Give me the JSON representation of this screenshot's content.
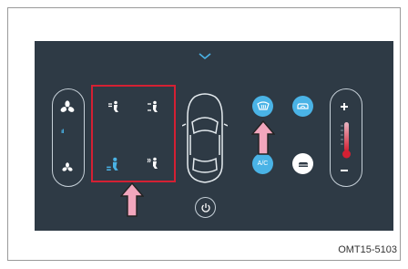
{
  "panel": {
    "ac_label": "A/C",
    "fan_level_bars": "ıılll"
  },
  "footer": {
    "code": "OMT15-5103"
  },
  "colors": {
    "panel_bg": "#2e3a45",
    "active_blue": "#4ab3e6",
    "highlight_red": "#d42033",
    "arrow_pink": "#f2a6bd"
  },
  "icons": {
    "collapse": "chevron-down-icon",
    "fan_high": "fan-icon",
    "fan_low": "fan-icon",
    "mode_face": "vent-face-icon",
    "mode_face_feet": "vent-face-feet-icon",
    "mode_feet": "vent-feet-icon",
    "mode_feet_defrost": "vent-feet-defrost-icon",
    "front_defrost": "front-defrost-icon",
    "recirculation": "recirculation-icon",
    "ac": "ac-icon",
    "fresh_air": "fresh-air-icon",
    "power": "power-icon",
    "temp_up": "plus-icon",
    "temp_down": "minus-icon",
    "thermometer": "thermometer-icon",
    "car": "car-icon"
  }
}
